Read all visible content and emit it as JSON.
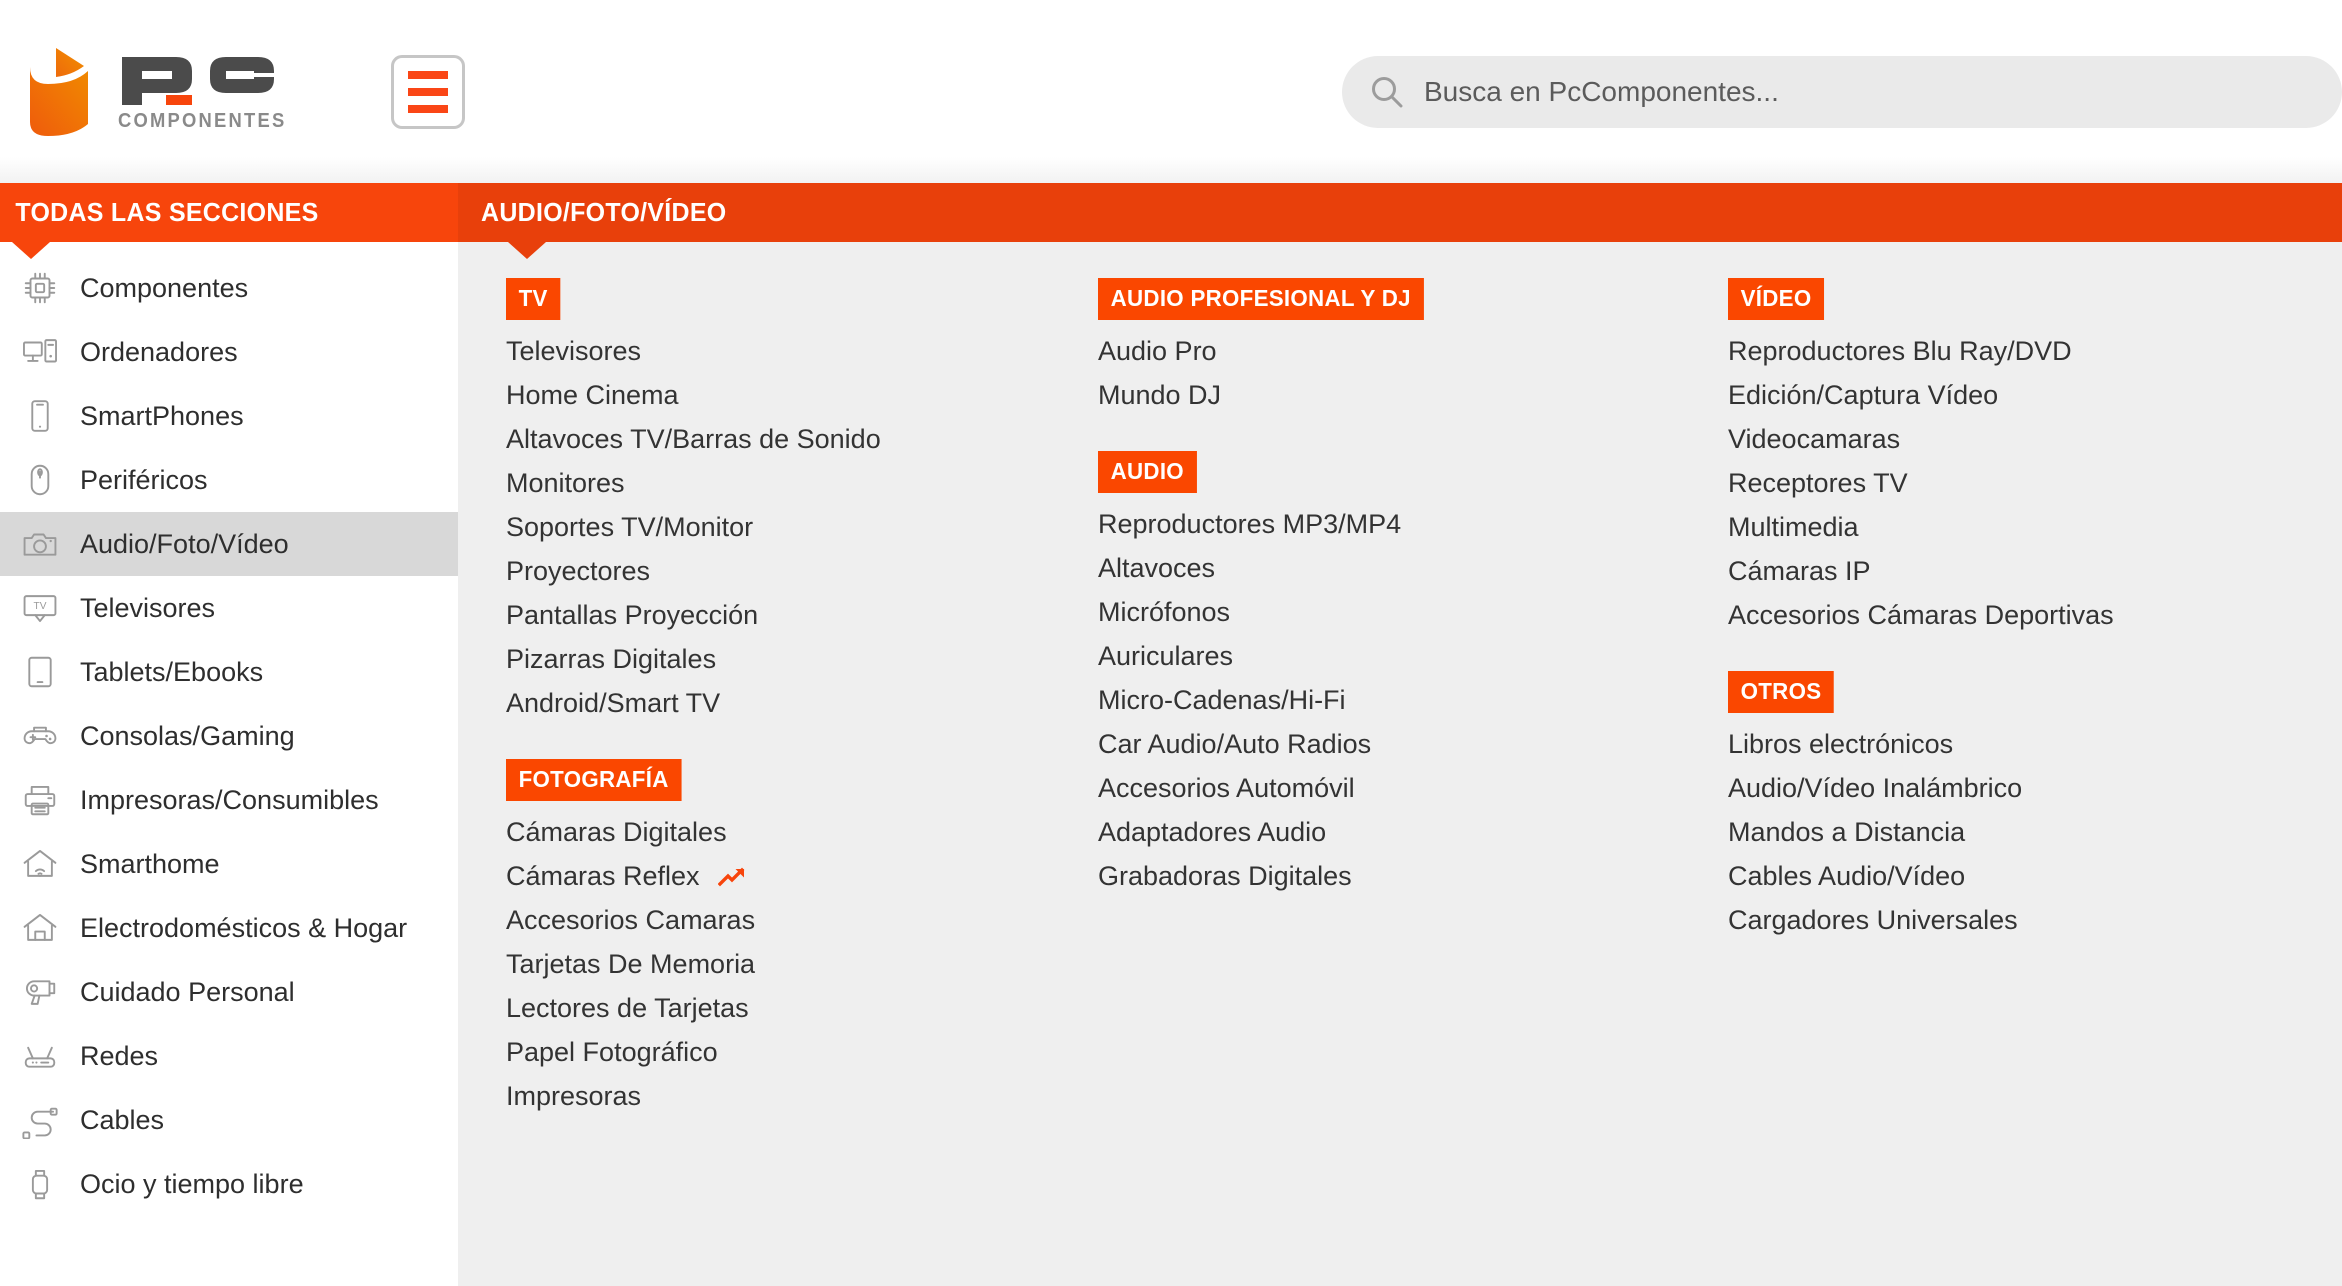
{
  "brand": {
    "name": "PC",
    "subtitle": "COMPONENTES",
    "accent_color": "#fa4616",
    "accent_dark": "#e8400b",
    "logo_icon": "pccomponentes-logo-icon"
  },
  "header": {
    "menu_button_icon": "hamburger-menu-icon",
    "search": {
      "icon": "search-icon",
      "placeholder": "Busca en PcComponentes...",
      "value": ""
    }
  },
  "nav": {
    "sidebar_title": "TODAS LAS SECCIONES",
    "panel_title": "AUDIO/FOTO/VÍDEO"
  },
  "sidebar": {
    "items": [
      {
        "label": "Componentes",
        "icon": "chip-icon",
        "active": false
      },
      {
        "label": "Ordenadores",
        "icon": "desktop-computer-icon",
        "active": false
      },
      {
        "label": "SmartPhones",
        "icon": "smartphone-icon",
        "active": false
      },
      {
        "label": "Periféricos",
        "icon": "mouse-icon",
        "active": false
      },
      {
        "label": "Audio/Foto/Vídeo",
        "icon": "camera-icon",
        "active": true
      },
      {
        "label": "Televisores",
        "icon": "tv-icon",
        "active": false
      },
      {
        "label": "Tablets/Ebooks",
        "icon": "tablet-icon",
        "active": false
      },
      {
        "label": "Consolas/Gaming",
        "icon": "gamepad-icon",
        "active": false
      },
      {
        "label": "Impresoras/Consumibles",
        "icon": "printer-icon",
        "active": false
      },
      {
        "label": "Smarthome",
        "icon": "smart-home-icon",
        "active": false
      },
      {
        "label": "Electrodomésticos & Hogar",
        "icon": "house-icon",
        "active": false
      },
      {
        "label": "Cuidado Personal",
        "icon": "hairdryer-icon",
        "active": false
      },
      {
        "label": "Redes",
        "icon": "router-icon",
        "active": false
      },
      {
        "label": "Cables",
        "icon": "cable-icon",
        "active": false
      },
      {
        "label": "Ocio y tiempo libre",
        "icon": "smartwatch-icon",
        "active": false
      }
    ]
  },
  "panel": {
    "columns": [
      {
        "groups": [
          {
            "title": "TV",
            "links": [
              {
                "label": "Televisores"
              },
              {
                "label": "Home Cinema"
              },
              {
                "label": "Altavoces TV/Barras de Sonido"
              },
              {
                "label": "Monitores"
              },
              {
                "label": "Soportes TV/Monitor"
              },
              {
                "label": "Proyectores"
              },
              {
                "label": "Pantallas Proyección"
              },
              {
                "label": "Pizarras Digitales"
              },
              {
                "label": "Android/Smart TV"
              }
            ]
          },
          {
            "title": "FOTOGRAFÍA",
            "links": [
              {
                "label": "Cámaras Digitales"
              },
              {
                "label": "Cámaras Reflex",
                "badge_icon": "trending-up-icon"
              },
              {
                "label": "Accesorios Camaras"
              },
              {
                "label": "Tarjetas De Memoria"
              },
              {
                "label": "Lectores de Tarjetas"
              },
              {
                "label": "Papel Fotográfico"
              },
              {
                "label": "Impresoras"
              }
            ]
          }
        ]
      },
      {
        "groups": [
          {
            "title": "AUDIO PROFESIONAL Y DJ",
            "links": [
              {
                "label": "Audio Pro"
              },
              {
                "label": "Mundo DJ"
              }
            ]
          },
          {
            "title": "AUDIO",
            "links": [
              {
                "label": "Reproductores MP3/MP4"
              },
              {
                "label": "Altavoces"
              },
              {
                "label": "Micrófonos"
              },
              {
                "label": "Auriculares"
              },
              {
                "label": "Micro-Cadenas/Hi-Fi"
              },
              {
                "label": "Car Audio/Auto Radios"
              },
              {
                "label": "Accesorios Automóvil"
              },
              {
                "label": "Adaptadores Audio"
              },
              {
                "label": "Grabadoras Digitales"
              }
            ]
          }
        ]
      },
      {
        "groups": [
          {
            "title": "VÍDEO",
            "links": [
              {
                "label": "Reproductores Blu Ray/DVD"
              },
              {
                "label": "Edición/Captura Vídeo"
              },
              {
                "label": "Videocamaras"
              },
              {
                "label": "Receptores TV"
              },
              {
                "label": "Multimedia"
              },
              {
                "label": "Cámaras IP"
              },
              {
                "label": "Accesorios Cámaras Deportivas"
              }
            ]
          },
          {
            "title": "OTROS",
            "links": [
              {
                "label": "Libros electrónicos"
              },
              {
                "label": "Audio/Vídeo Inalámbrico"
              },
              {
                "label": "Mandos a Distancia"
              },
              {
                "label": "Cables Audio/Vídeo"
              },
              {
                "label": "Cargadores Universales"
              }
            ]
          }
        ]
      }
    ]
  }
}
